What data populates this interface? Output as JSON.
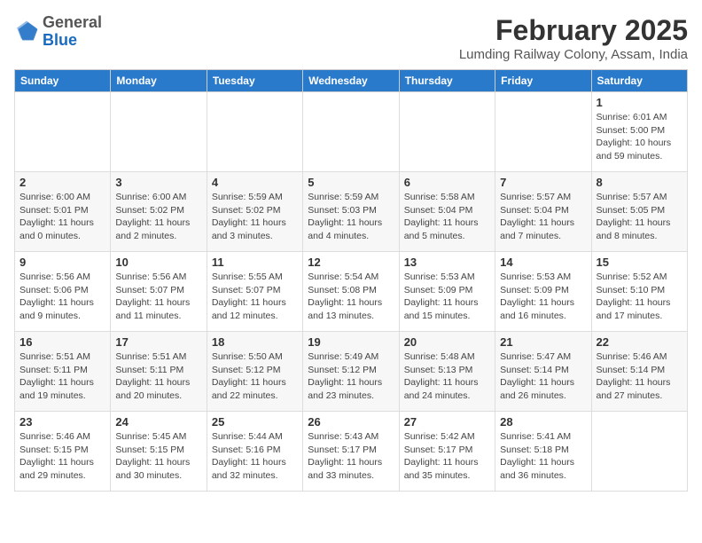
{
  "header": {
    "logo_general": "General",
    "logo_blue": "Blue",
    "month_title": "February 2025",
    "location": "Lumding Railway Colony, Assam, India"
  },
  "weekdays": [
    "Sunday",
    "Monday",
    "Tuesday",
    "Wednesday",
    "Thursday",
    "Friday",
    "Saturday"
  ],
  "weeks": [
    [
      null,
      null,
      null,
      null,
      null,
      null,
      {
        "day": "1",
        "sunrise": "6:01 AM",
        "sunset": "5:00 PM",
        "daylight": "10 hours and 59 minutes."
      }
    ],
    [
      {
        "day": "2",
        "sunrise": "6:00 AM",
        "sunset": "5:01 PM",
        "daylight": "11 hours and 0 minutes."
      },
      {
        "day": "3",
        "sunrise": "6:00 AM",
        "sunset": "5:02 PM",
        "daylight": "11 hours and 2 minutes."
      },
      {
        "day": "4",
        "sunrise": "5:59 AM",
        "sunset": "5:02 PM",
        "daylight": "11 hours and 3 minutes."
      },
      {
        "day": "5",
        "sunrise": "5:59 AM",
        "sunset": "5:03 PM",
        "daylight": "11 hours and 4 minutes."
      },
      {
        "day": "6",
        "sunrise": "5:58 AM",
        "sunset": "5:04 PM",
        "daylight": "11 hours and 5 minutes."
      },
      {
        "day": "7",
        "sunrise": "5:57 AM",
        "sunset": "5:04 PM",
        "daylight": "11 hours and 7 minutes."
      },
      {
        "day": "8",
        "sunrise": "5:57 AM",
        "sunset": "5:05 PM",
        "daylight": "11 hours and 8 minutes."
      }
    ],
    [
      {
        "day": "9",
        "sunrise": "5:56 AM",
        "sunset": "5:06 PM",
        "daylight": "11 hours and 9 minutes."
      },
      {
        "day": "10",
        "sunrise": "5:56 AM",
        "sunset": "5:07 PM",
        "daylight": "11 hours and 11 minutes."
      },
      {
        "day": "11",
        "sunrise": "5:55 AM",
        "sunset": "5:07 PM",
        "daylight": "11 hours and 12 minutes."
      },
      {
        "day": "12",
        "sunrise": "5:54 AM",
        "sunset": "5:08 PM",
        "daylight": "11 hours and 13 minutes."
      },
      {
        "day": "13",
        "sunrise": "5:53 AM",
        "sunset": "5:09 PM",
        "daylight": "11 hours and 15 minutes."
      },
      {
        "day": "14",
        "sunrise": "5:53 AM",
        "sunset": "5:09 PM",
        "daylight": "11 hours and 16 minutes."
      },
      {
        "day": "15",
        "sunrise": "5:52 AM",
        "sunset": "5:10 PM",
        "daylight": "11 hours and 17 minutes."
      }
    ],
    [
      {
        "day": "16",
        "sunrise": "5:51 AM",
        "sunset": "5:11 PM",
        "daylight": "11 hours and 19 minutes."
      },
      {
        "day": "17",
        "sunrise": "5:51 AM",
        "sunset": "5:11 PM",
        "daylight": "11 hours and 20 minutes."
      },
      {
        "day": "18",
        "sunrise": "5:50 AM",
        "sunset": "5:12 PM",
        "daylight": "11 hours and 22 minutes."
      },
      {
        "day": "19",
        "sunrise": "5:49 AM",
        "sunset": "5:12 PM",
        "daylight": "11 hours and 23 minutes."
      },
      {
        "day": "20",
        "sunrise": "5:48 AM",
        "sunset": "5:13 PM",
        "daylight": "11 hours and 24 minutes."
      },
      {
        "day": "21",
        "sunrise": "5:47 AM",
        "sunset": "5:14 PM",
        "daylight": "11 hours and 26 minutes."
      },
      {
        "day": "22",
        "sunrise": "5:46 AM",
        "sunset": "5:14 PM",
        "daylight": "11 hours and 27 minutes."
      }
    ],
    [
      {
        "day": "23",
        "sunrise": "5:46 AM",
        "sunset": "5:15 PM",
        "daylight": "11 hours and 29 minutes."
      },
      {
        "day": "24",
        "sunrise": "5:45 AM",
        "sunset": "5:15 PM",
        "daylight": "11 hours and 30 minutes."
      },
      {
        "day": "25",
        "sunrise": "5:44 AM",
        "sunset": "5:16 PM",
        "daylight": "11 hours and 32 minutes."
      },
      {
        "day": "26",
        "sunrise": "5:43 AM",
        "sunset": "5:17 PM",
        "daylight": "11 hours and 33 minutes."
      },
      {
        "day": "27",
        "sunrise": "5:42 AM",
        "sunset": "5:17 PM",
        "daylight": "11 hours and 35 minutes."
      },
      {
        "day": "28",
        "sunrise": "5:41 AM",
        "sunset": "5:18 PM",
        "daylight": "11 hours and 36 minutes."
      },
      null
    ]
  ]
}
